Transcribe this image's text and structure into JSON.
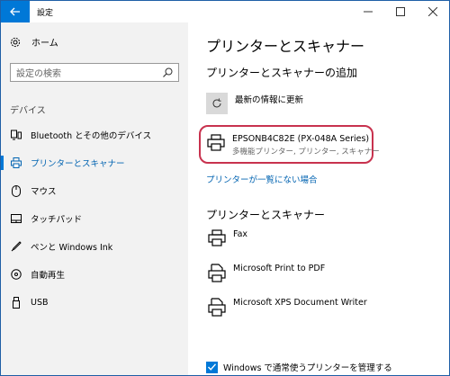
{
  "window": {
    "title": "設定",
    "controls": {
      "minimize": "—",
      "maximize": "☐",
      "close": "✕"
    }
  },
  "sidebar": {
    "home_label": "ホーム",
    "search_placeholder": "設定の検索",
    "section_header": "デバイス",
    "items": [
      {
        "label": "Bluetooth とその他のデバイス",
        "icon": "bluetooth-devices-icon"
      },
      {
        "label": "プリンターとスキャナー",
        "icon": "printer-icon",
        "active": true
      },
      {
        "label": "マウス",
        "icon": "mouse-icon"
      },
      {
        "label": "タッチパッド",
        "icon": "touchpad-icon"
      },
      {
        "label": "ペンと Windows Ink",
        "icon": "pen-icon"
      },
      {
        "label": "自動再生",
        "icon": "autoplay-icon"
      },
      {
        "label": "USB",
        "icon": "usb-icon"
      }
    ]
  },
  "main": {
    "title": "プリンターとスキャナー",
    "add_section_title": "プリンターとスキャナーの追加",
    "refresh_label": "最新の情報に更新",
    "highlighted_printer": {
      "name": "EPSONB4C82E (PX-048A Series)",
      "description": "多機能プリンター, プリンター, スキャナー"
    },
    "not_listed_link": "プリンターが一覧にない場合",
    "list_section_title": "プリンターとスキャナー",
    "printers": [
      {
        "name": "Fax"
      },
      {
        "name": "Microsoft Print to PDF"
      },
      {
        "name": "Microsoft XPS Document Writer"
      }
    ],
    "manage_checkbox_label": "Windows で通常使うプリンターを管理する",
    "manage_checkbox_checked": true
  },
  "colors": {
    "accent": "#0078d7",
    "highlight_border": "#c8324e",
    "sidebar_bg": "#f2f2f2"
  }
}
